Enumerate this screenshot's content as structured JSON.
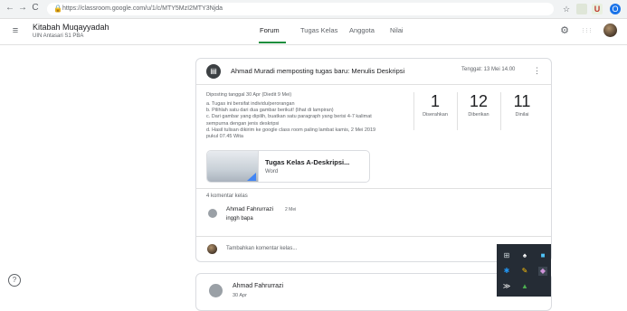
{
  "browser": {
    "url": "https://classroom.google.com/u/1/c/MTY5MzI2MTY3Njda",
    "back_glyph": "←",
    "forward_glyph": "→",
    "reload_glyph": "C",
    "lock_glyph": "🔒",
    "star_glyph": "☆",
    "ext_u_label": "U",
    "ext_o_label": "O"
  },
  "header": {
    "menu_glyph": "≡",
    "class_name": "Kitabah Muqayyadah",
    "class_section": "UIN Antasari S1 PBA",
    "tabs": [
      {
        "label": "Forum",
        "active": true
      },
      {
        "label": "Tugas Kelas",
        "active": false
      },
      {
        "label": "Anggota",
        "active": false
      },
      {
        "label": "Nilai",
        "active": false
      }
    ],
    "settings_glyph": "⚙",
    "apps_glyph": "⋮⋮⋮"
  },
  "post": {
    "icon_glyph": "▤",
    "title": "Ahmad Muradi memposting tugas baru: Menulis Deskripsi",
    "due": "Tenggat: 13 Mei 14.00",
    "menu_glyph": "⋮",
    "posted_date": "Diposting tanggal 30 Apr (Diedit 9 Mei)",
    "description": [
      "a. Tugas ini bersifat individu/perorangan",
      "b. Pilihlah satu dari dua gambar berikut! (lihat di lampiran)",
      "c. Dari gambar yang dipilih, buatkan satu paragraph yang berisi 4-7 kalimat",
      "sempurna dengan jenis deskripsi",
      "d. Hasil tulisan dikirim ke google class room paling lambat kamis, 2 Mei 2019",
      "pukul 07.45 Wita"
    ],
    "stats": [
      {
        "number": "1",
        "label": "Diserahkan"
      },
      {
        "number": "12",
        "label": "Diberikan"
      },
      {
        "number": "11",
        "label": "Dinilai"
      }
    ],
    "attachment": {
      "title": "Tugas Kelas A-Deskripsi...",
      "type": "Word"
    },
    "comments_count": "4 komentar kelas",
    "comment": {
      "author": "Ahmad Fahrurrazi",
      "date": "2 Mei",
      "text": "inggh bapa"
    },
    "add_comment_placeholder": "Tambahkan komentar kelas..."
  },
  "next_post": {
    "author": "Ahmad Fahrurrazi",
    "date": "30 Apr"
  },
  "help_glyph": "?",
  "tray": {
    "icons": [
      "⊞",
      "♠",
      "■",
      "✱",
      "✎",
      "◆",
      "≫",
      "▲"
    ]
  }
}
